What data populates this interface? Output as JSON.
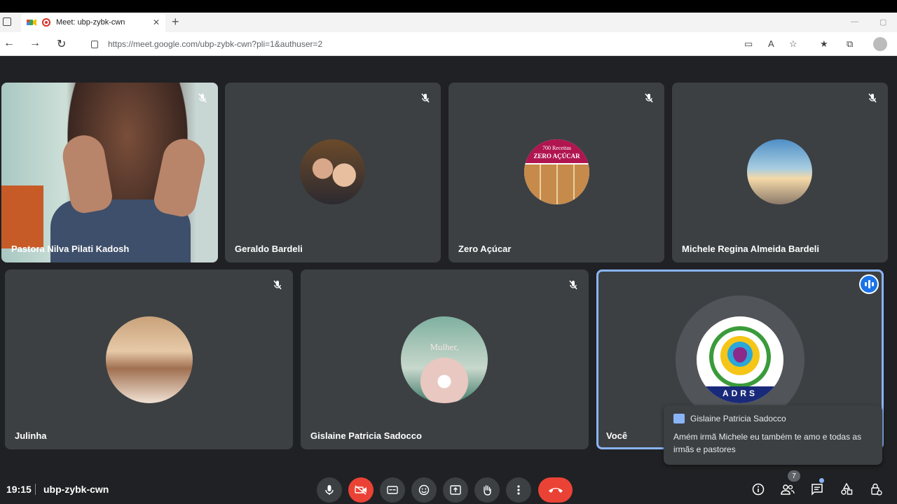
{
  "browser": {
    "tab_title": "Meet: ubp-zybk-cwn",
    "url": "https://meet.google.com/ubp-zybk-cwn?pli=1&authuser=2"
  },
  "participants": [
    {
      "name": "Pastora Nilva Pilati Kadosh"
    },
    {
      "name": "Geraldo Bardeli"
    },
    {
      "name": "Zero Açúcar",
      "avatar_text_line1": "700 Receitas",
      "avatar_text_line2": "ZERO AÇÚCAR"
    },
    {
      "name": "Michele Regina Almeida Bardeli"
    },
    {
      "name": "Julinha"
    },
    {
      "name": "Gislaine Patricia Sadocco",
      "avatar_text_line1": "Mulher,"
    },
    {
      "name": "Você",
      "avatar_text": "ADRS"
    }
  ],
  "chat_popup": {
    "sender": "Gislaine Patricia Sadocco",
    "message": "Amém irmã Michele eu também te amo e todas as irmãs e pastores"
  },
  "bottom_bar": {
    "time": "19:15",
    "meeting_code": "ubp-zybk-cwn",
    "participant_count": "7"
  },
  "colors": {
    "background": "#202124",
    "tile": "#3c4043",
    "accent": "#8ab4f8",
    "danger": "#ea4335"
  }
}
